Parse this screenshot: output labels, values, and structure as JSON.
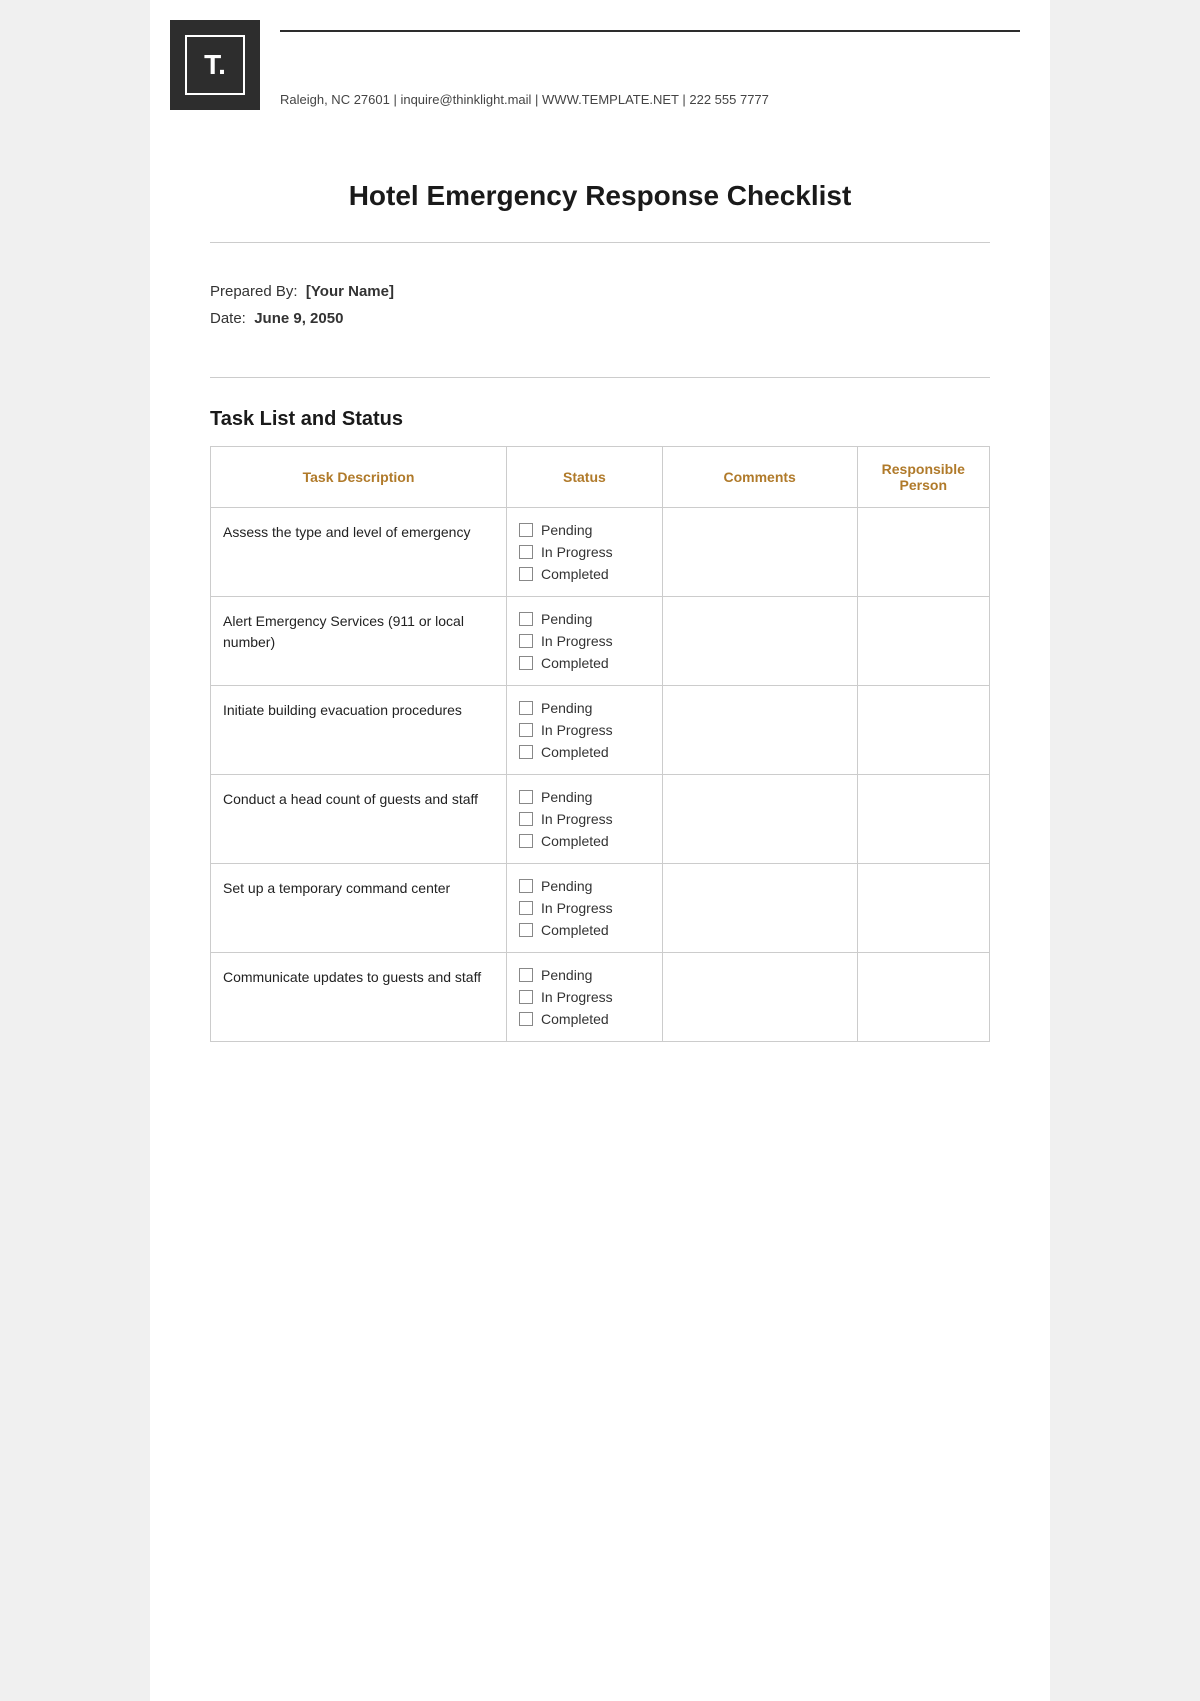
{
  "logo": {
    "text": "T.",
    "alt": "Thinklight Logo"
  },
  "header": {
    "contact": "Raleigh, NC 27601 | inquire@thinklight.mail | WWW.TEMPLATE.NET | 222 555 7777",
    "line_visible": true
  },
  "document": {
    "title": "Hotel Emergency Response Checklist",
    "prepared_by_label": "Prepared By:",
    "prepared_by_value": "[Your Name]",
    "date_label": "Date:",
    "date_value": "June 9, 2050",
    "section_title": "Task List and Status"
  },
  "table": {
    "columns": [
      {
        "key": "task",
        "label": "Task Description"
      },
      {
        "key": "status",
        "label": "Status"
      },
      {
        "key": "comments",
        "label": "Comments"
      },
      {
        "key": "responsible",
        "label": "Responsible Person"
      }
    ],
    "status_options": [
      "Pending",
      "In Progress",
      "Completed"
    ],
    "rows": [
      {
        "task": "Assess the type and level of emergency",
        "comments": "",
        "responsible": ""
      },
      {
        "task": "Alert Emergency Services (911 or local number)",
        "comments": "",
        "responsible": ""
      },
      {
        "task": "Initiate building evacuation procedures",
        "comments": "",
        "responsible": ""
      },
      {
        "task": "Conduct a head count of guests and staff",
        "comments": "",
        "responsible": ""
      },
      {
        "task": "Set up a temporary command center",
        "comments": "",
        "responsible": ""
      },
      {
        "task": "Communicate updates to guests and staff",
        "comments": "",
        "responsible": ""
      }
    ]
  }
}
